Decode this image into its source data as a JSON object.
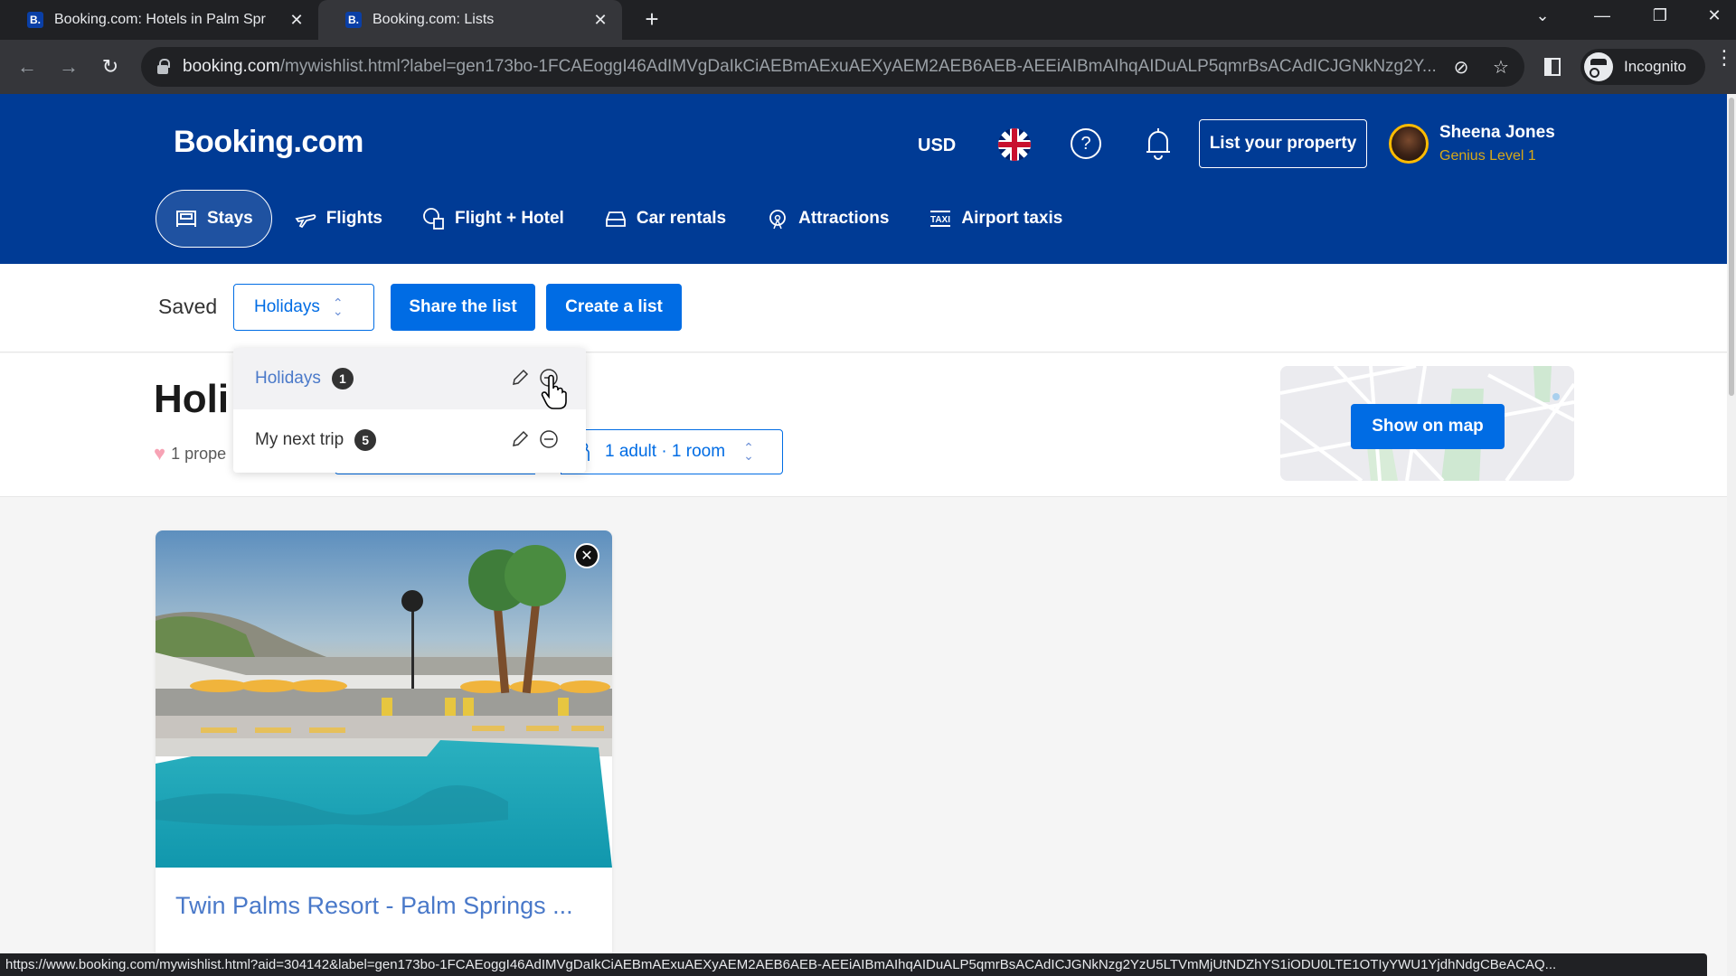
{
  "browser": {
    "tabs": [
      {
        "favicon": "B.",
        "title": "Booking.com: Hotels in Palm Spr",
        "active": false
      },
      {
        "favicon": "B.",
        "title": "Booking.com: Lists",
        "active": true
      }
    ],
    "new_tab_label": "+",
    "url_host": "booking.com",
    "url_path": "/mywishlist.html?label=gen173bo-1FCAEoggI46AdIMVgDaIkCiAEBmAExuAEXyAEM2AEB6AEB-AEEiAIBmAIhqAIDuALP5qmrBsACAdICJGNkNzg2Y...",
    "incognito_label": "Incognito",
    "status_url": "https://www.booking.com/mywishlist.html?aid=304142&label=gen173bo-1FCAEoggI46AdIMVgDaIkCiAEBmAExuAEXyAEM2AEB6AEB-AEEiAIBmAIhqAIDuALP5qmrBsACAdICJGNkNzg2YzU5LTVmMjUtNDZhYS1iODU0LTE1OTIyYWU1YjdhNdgCBeACAQ..."
  },
  "header": {
    "logo": "Booking.com",
    "currency": "USD",
    "language_icon": "uk-flag-icon",
    "list_property_label": "List your property",
    "user": {
      "name": "Sheena Jones",
      "level": "Genius Level 1"
    }
  },
  "nav": {
    "items": [
      {
        "label": "Stays",
        "icon": "bed-icon",
        "active": true
      },
      {
        "label": "Flights",
        "icon": "plane-icon",
        "active": false
      },
      {
        "label": "Flight + Hotel",
        "icon": "flight-hotel-icon",
        "active": false
      },
      {
        "label": "Car rentals",
        "icon": "car-icon",
        "active": false
      },
      {
        "label": "Attractions",
        "icon": "attractions-icon",
        "active": false
      },
      {
        "label": "Airport taxis",
        "icon": "taxi-icon",
        "active": false
      }
    ]
  },
  "toolbar": {
    "saved_label": "Saved",
    "selected_list": "Holidays",
    "share_label": "Share the list",
    "create_label": "Create a list"
  },
  "dropdown": {
    "lists": [
      {
        "name": "Holidays",
        "count": "1",
        "selected": true
      },
      {
        "name": "My next trip",
        "count": "5",
        "selected": false
      }
    ]
  },
  "list_header": {
    "title": "Holi",
    "property_count": "1 prope",
    "guests": "1 adult · 1 room",
    "show_map_label": "Show on map"
  },
  "cards": [
    {
      "name": "Twin Palms Resort - Palm Springs ...",
      "remove_icon": "close-icon"
    }
  ],
  "colors": {
    "brand_blue": "#003b95",
    "action_blue": "#006ce4",
    "link_blue": "#4a79c9",
    "genius_yellow": "#febb02"
  }
}
